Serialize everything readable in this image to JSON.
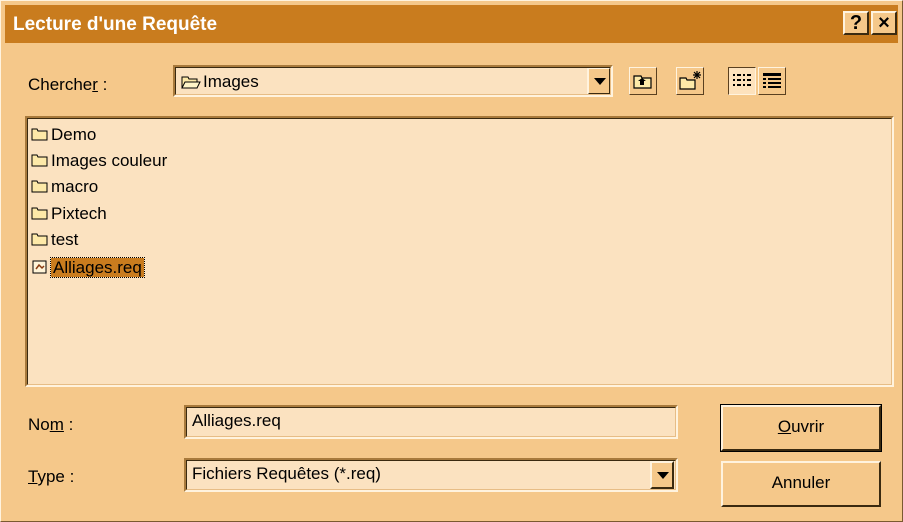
{
  "titlebar": {
    "title": "Lecture d'une Requête",
    "help_label": "?",
    "close_label": "×"
  },
  "look_in": {
    "label_pre": "Cherche",
    "label_accel": "r",
    "label_post": " :",
    "value": "Images"
  },
  "files": [
    {
      "name": "Demo",
      "type": "folder"
    },
    {
      "name": "Images couleur",
      "type": "folder"
    },
    {
      "name": "macro",
      "type": "folder"
    },
    {
      "name": "Pixtech",
      "type": "folder"
    },
    {
      "name": "test",
      "type": "folder"
    },
    {
      "name": "Alliages.req",
      "type": "file",
      "selected": true
    }
  ],
  "name_field": {
    "label_pre": "No",
    "label_accel": "m",
    "label_post": " :",
    "value": "Alliages.req"
  },
  "type_field": {
    "label_accel": "T",
    "label_post": "ype :",
    "value": "Fichiers Requêtes (*.req)"
  },
  "buttons": {
    "open_accel": "O",
    "open_rest": "uvrir",
    "cancel": "Annuler"
  },
  "colors": {
    "titlebar": "#c97c1e",
    "dialog_bg": "#f5c88a",
    "field_bg": "#fbe2c0",
    "selection": "#c97c1e"
  }
}
